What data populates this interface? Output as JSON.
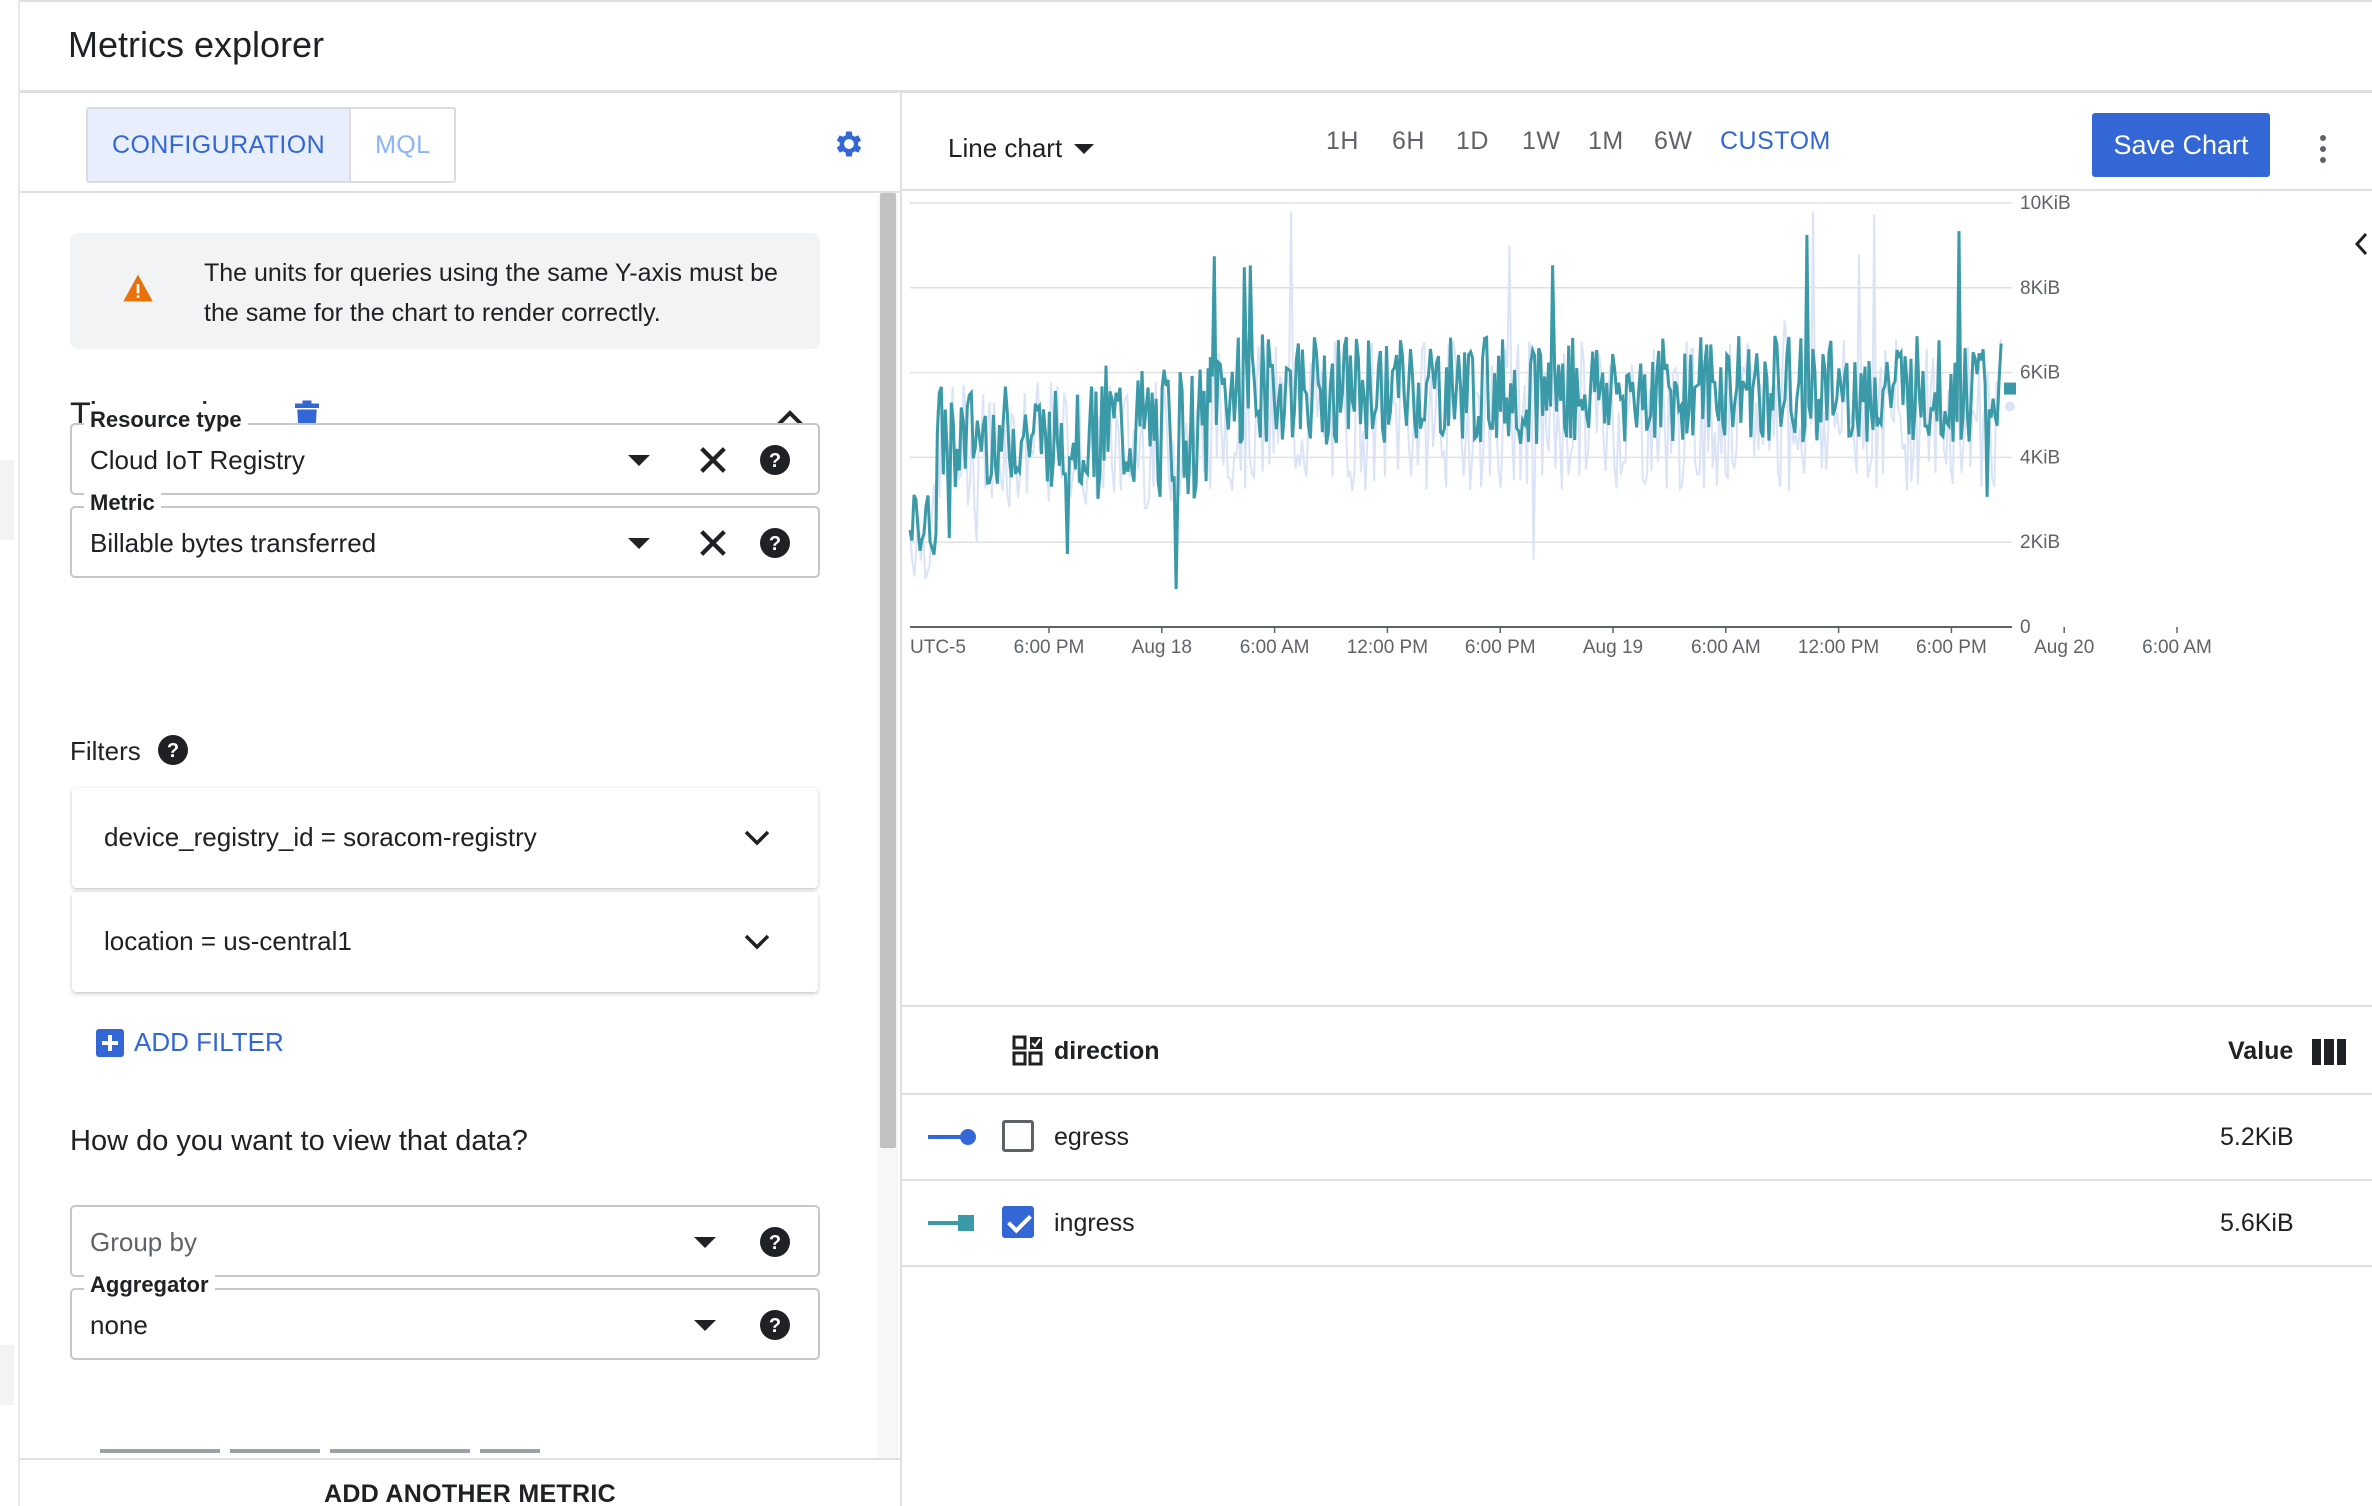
{
  "header": {
    "title": "Metrics explorer"
  },
  "config": {
    "tabs": [
      {
        "label": "CONFIGURATION",
        "active": true
      },
      {
        "label": "MQL",
        "active": false
      }
    ],
    "warning": "The units for queries using the same Y-axis must be the same for the chart to render correctly.",
    "section_title": "Time series",
    "resource_type": {
      "label": "Resource type",
      "value": "Cloud IoT Registry"
    },
    "metric": {
      "label": "Metric",
      "value": "Billable bytes transferred"
    },
    "filters_label": "Filters",
    "filters": [
      {
        "text": "device_registry_id = soracom-registry"
      },
      {
        "text": "location = us-central1"
      }
    ],
    "add_filter": "ADD FILTER",
    "view_question": "How do you want to view that data?",
    "group_by": {
      "placeholder": "Group by"
    },
    "aggregator": {
      "label": "Aggregator",
      "value": "none"
    },
    "footer_button": "ADD ANOTHER METRIC"
  },
  "toolbar": {
    "chart_type": "Line chart",
    "ranges": [
      "1H",
      "6H",
      "1D",
      "1W",
      "1M",
      "6W",
      "CUSTOM"
    ],
    "active_range": "CUSTOM",
    "save_label": "Save Chart"
  },
  "colors": {
    "accent": "#3367d6",
    "ingress": "#3b9aa8",
    "egress_light": "#dbe3f6",
    "egress_legend": "#3367d6",
    "warning": "#e8710a"
  },
  "chart_data": {
    "type": "line",
    "timezone_label": "UTC-5",
    "x_ticks": [
      "6:00 PM",
      "Aug 18",
      "6:00 AM",
      "12:00 PM",
      "6:00 PM",
      "Aug 19",
      "6:00 AM",
      "12:00 PM",
      "6:00 PM",
      "Aug 20",
      "6:00 AM"
    ],
    "y_ticks": [
      "0",
      "2KiB",
      "4KiB",
      "6KiB",
      "8KiB",
      "10KiB"
    ],
    "ylim": [
      0,
      10
    ],
    "yunit": "KiB",
    "grid": true,
    "series": [
      {
        "name": "ingress",
        "style": "noisy-line",
        "segments": [
          {
            "x": [
              0.0,
              0.15
            ],
            "level": 2.4,
            "noise": 0.8
          },
          {
            "x": [
              0.15,
              1.0
            ],
            "level": 4.5,
            "noise": 1.2
          },
          {
            "x": [
              1.0,
              1.65
            ],
            "level": 4.6,
            "noise": 1.6
          },
          {
            "x": [
              1.65,
              6.0
            ],
            "level": 5.6,
            "noise": 1.3
          }
        ]
      },
      {
        "name": "egress",
        "style": "faint-line",
        "segments": [
          {
            "x": [
              0.0,
              0.15
            ],
            "level": 2.2,
            "noise": 1.2
          },
          {
            "x": [
              0.15,
              1.65
            ],
            "level": 4.3,
            "noise": 1.5
          },
          {
            "x": [
              1.65,
              6.0
            ],
            "level": 5.0,
            "noise": 1.8
          }
        ]
      }
    ]
  },
  "legend": {
    "dimension_label": "direction",
    "value_label": "Value",
    "rows": [
      {
        "name": "egress",
        "value": "5.2KiB",
        "checked": false
      },
      {
        "name": "ingress",
        "value": "5.6KiB",
        "checked": true
      }
    ]
  }
}
